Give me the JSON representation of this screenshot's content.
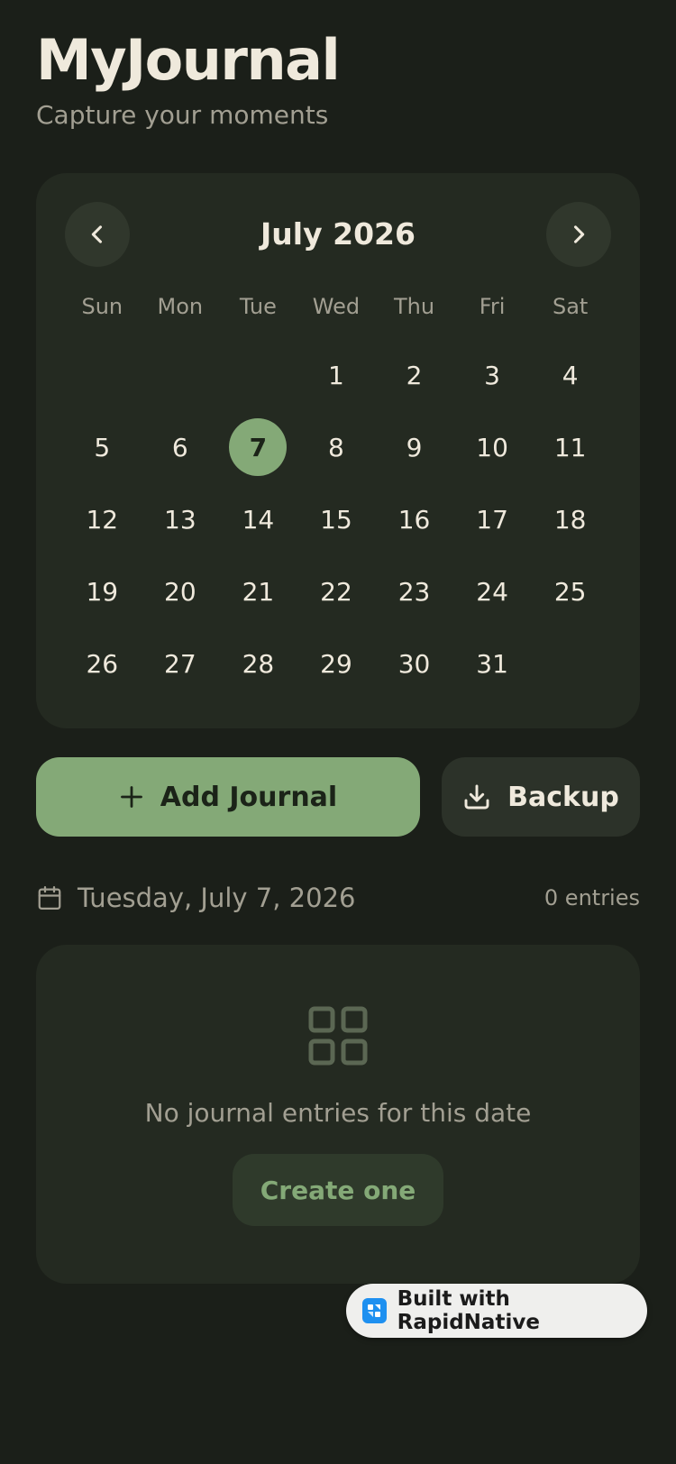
{
  "app": {
    "title": "MyJournal",
    "subtitle": "Capture your moments"
  },
  "calendar": {
    "month_label": "July 2026",
    "weekdays": [
      "Sun",
      "Mon",
      "Tue",
      "Wed",
      "Thu",
      "Fri",
      "Sat"
    ],
    "days": [
      "",
      "",
      "",
      "1",
      "2",
      "3",
      "4",
      "5",
      "6",
      "7",
      "8",
      "9",
      "10",
      "11",
      "12",
      "13",
      "14",
      "15",
      "16",
      "17",
      "18",
      "19",
      "20",
      "21",
      "22",
      "23",
      "24",
      "25",
      "26",
      "27",
      "28",
      "29",
      "30",
      "31"
    ],
    "selected_day": "7",
    "prev_icon": "chevron-left-icon",
    "next_icon": "chevron-right-icon"
  },
  "actions": {
    "add_label": "Add Journal",
    "add_icon": "plus-icon",
    "backup_label": "Backup",
    "backup_icon": "download-icon"
  },
  "selected_date": {
    "label": "Tuesday, July 7, 2026",
    "entries": "0 entries",
    "icon": "calendar-icon"
  },
  "empty_state": {
    "icon": "grid-icon",
    "message": "No journal entries for this date",
    "cta_label": "Create one"
  },
  "badge": {
    "label": "Built with RapidNative"
  },
  "colors": {
    "background": "#1b1f19",
    "card": "#242a21",
    "accent": "#84a977",
    "text": "#efe9dc",
    "muted": "#a29f92"
  }
}
